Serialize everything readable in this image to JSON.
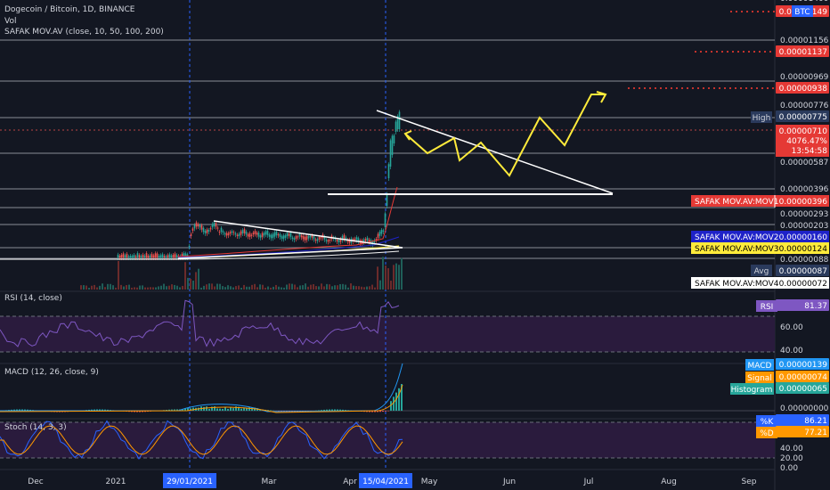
{
  "header": {
    "title": "Dogecoin / Bitcoin, 1D, BINANCE",
    "vol": "Vol",
    "indicator": "SAFAK MOV.AV (close, 10, 50, 100, 200)"
  },
  "price_axis": {
    "top_partial": "0.00001400",
    "btc_badge": "BTC",
    "ticks": [
      "0.00001156",
      "0.00000969",
      "0.00000776",
      "0.00000587",
      "0.00000396",
      "0.00000293",
      "0.00000203",
      "0.00000088"
    ],
    "red_boxes": [
      "0.00001149",
      "0.00001137",
      "0.00000938"
    ],
    "high_label": "High",
    "high_value": "0.00000775",
    "last_price": "0.00000710",
    "change": "4076.47%",
    "countdown": "13:54:58",
    "ma_labels": [
      {
        "name": "SAFAK MOV.AV:MOV1",
        "value": "0.00000396",
        "color": "#e53935",
        "text": "#ffffff"
      },
      {
        "name": "SAFAK MOV.AV:MOV2",
        "value": "0.00000160",
        "color": "#1e22c8",
        "text": "#ffffff"
      },
      {
        "name": "SAFAK MOV.AV:MOV3",
        "value": "0.00000124",
        "color": "#ffeb3b",
        "text": "#000000"
      },
      {
        "name": "SAFAK MOV.AV:MOV4",
        "value": "0.00000072",
        "color": "#ffffff",
        "text": "#000000"
      }
    ],
    "avg_label": "Avg",
    "avg_value": "0.00000087"
  },
  "rsi": {
    "label": "RSI (14, close)",
    "badge": "RSI",
    "value": "81.37",
    "ticks": [
      "60.00",
      "40.00"
    ]
  },
  "macd": {
    "label": "MACD (12, 26, close, 9)",
    "macd_label": "MACD",
    "macd_value": "0.00000139",
    "signal_label": "Signal",
    "signal_value": "0.00000074",
    "hist_label": "Histogram",
    "hist_value": "0.00000065",
    "zero": "0.00000000"
  },
  "stoch": {
    "label": "Stoch (14, 3, 3)",
    "k_label": "%K",
    "k_value": "86.21",
    "d_label": "%D",
    "d_value": "77.21",
    "ticks": [
      "40.00",
      "20.00",
      "0.00"
    ]
  },
  "time_axis": {
    "labels": [
      "Dec",
      "2021",
      "Mar",
      "Apr",
      "May",
      "Jun",
      "Jul",
      "Aug",
      "Sep"
    ],
    "highlight_1": "29/01/2021",
    "highlight_2": "15/04/2021"
  },
  "colors": {
    "background": "#131722",
    "up": "#26a69a",
    "down": "#ef5350",
    "rsi_line": "#7e57c2",
    "projection": "#ffeb3b",
    "trendline": "#ffffff",
    "axis_badge": "#2962ff"
  },
  "chart_data": [
    {
      "type": "line",
      "title": "Dogecoin / Bitcoin, 1D, BINANCE",
      "x_range": [
        "Dec 2020",
        "Sep 2021"
      ],
      "y_scale": "log",
      "series": [
        {
          "name": "SAFAK MOV.AV:MOV1",
          "last": 3.96e-06
        },
        {
          "name": "SAFAK MOV.AV:MOV2",
          "last": 1.6e-06
        },
        {
          "name": "SAFAK MOV.AV:MOV3",
          "last": 1.24e-06
        },
        {
          "name": "SAFAK MOV.AV:MOV4",
          "last": 7.2e-07
        }
      ],
      "last_price": 7.1e-06,
      "high": 7.75e-06,
      "horizontal_levels": [
        1.156e-05,
        9.69e-06,
        7.76e-06,
        5.87e-06,
        3.96e-06,
        2.93e-06,
        2.03e-06,
        8.8e-07
      ]
    },
    {
      "type": "line",
      "title": "RSI (14, close)",
      "last": 81.37,
      "levels": [
        60,
        40
      ]
    },
    {
      "type": "bar",
      "title": "MACD (12, 26, close, 9)",
      "macd": 1.39e-06,
      "signal": 7.4e-07,
      "histogram": 6.5e-07
    },
    {
      "type": "line",
      "title": "Stoch (14, 3, 3)",
      "k": 86.21,
      "d": 77.21
    }
  ]
}
